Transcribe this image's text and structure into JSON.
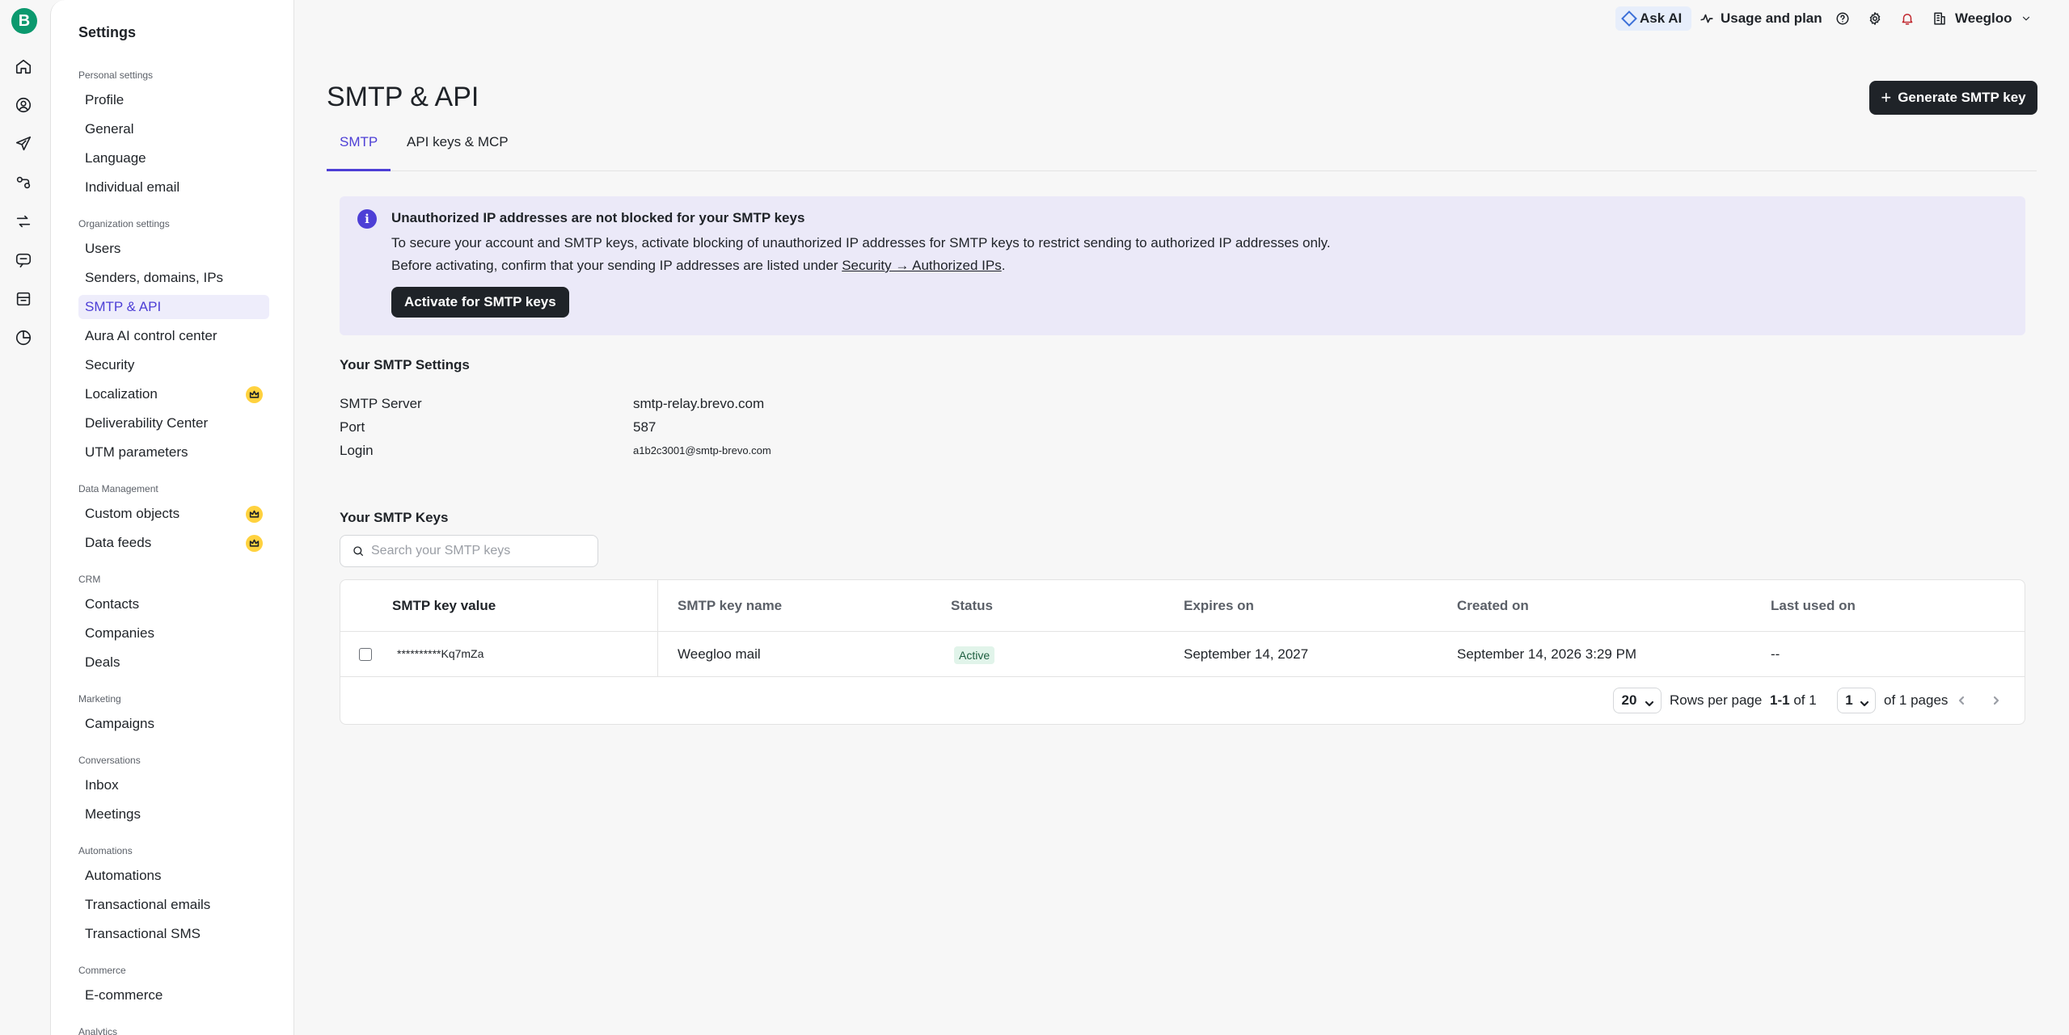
{
  "brand": {
    "logo_letter": "B",
    "accent": "#0b996e"
  },
  "topbar": {
    "ask_ai": "Ask AI",
    "usage": "Usage and plan",
    "account": "Weegloo"
  },
  "sidebar": {
    "title": "Settings",
    "sections": {
      "personal": "Personal settings",
      "organization": "Organization settings",
      "data": "Data Management",
      "crm": "CRM",
      "marketing": "Marketing",
      "conversations": "Conversations",
      "automations": "Automations",
      "commerce": "Commerce",
      "analytics": "Analytics"
    },
    "items": {
      "profile": "Profile",
      "general": "General",
      "language": "Language",
      "individual_email": "Individual email",
      "users": "Users",
      "senders": "Senders, domains, IPs",
      "smtp_api": "SMTP & API",
      "aura": "Aura AI control center",
      "security": "Security",
      "localization": "Localization",
      "deliverability": "Deliverability Center",
      "utm": "UTM parameters",
      "custom_objects": "Custom objects",
      "data_feeds": "Data feeds",
      "contacts": "Contacts",
      "companies": "Companies",
      "deals": "Deals",
      "campaigns": "Campaigns",
      "inbox": "Inbox",
      "meetings": "Meetings",
      "automations": "Automations",
      "transactional_emails": "Transactional emails",
      "transactional_sms": "Transactional SMS",
      "ecommerce": "E-commerce"
    }
  },
  "main": {
    "title": "SMTP & API",
    "generate_button": "Generate SMTP key",
    "tabs": [
      "SMTP",
      "API keys & MCP"
    ],
    "alert": {
      "title": "Unauthorized IP addresses are not blocked for your SMTP keys",
      "line1": "To secure your account and SMTP keys, activate blocking of unauthorized IP addresses for SMTP keys to restrict sending to authorized IP addresses only.",
      "line2_prefix": "Before activating, confirm that your sending IP addresses are listed under ",
      "line2_link": "Security → Authorized IPs",
      "line2_suffix": ".",
      "button": "Activate for SMTP keys"
    },
    "settings": {
      "heading": "Your SMTP Settings",
      "server_label": "SMTP Server",
      "server_value": "smtp-relay.brevo.com",
      "port_label": "Port",
      "port_value": "587",
      "login_label": "Login",
      "login_value": "a1b2c3001@smtp-brevo.com"
    },
    "keys": {
      "heading": "Your SMTP Keys",
      "search_placeholder": "Search your SMTP keys",
      "columns": [
        "SMTP key value",
        "SMTP key name",
        "Status",
        "Expires on",
        "Created on",
        "Last used on"
      ],
      "rows": [
        {
          "value": "**********Kq7mZa",
          "name": "Weegloo mail",
          "status": "Active",
          "expires": "September 14, 2027",
          "created": "September 14, 2026 3:29 PM",
          "last_used": "--"
        }
      ],
      "pagination": {
        "rows_per_page_value": "20",
        "rows_per_page_label": "Rows per page",
        "range": "1-1",
        "of_total": "of 1",
        "page_value": "1",
        "of_pages": "of 1 pages"
      }
    }
  }
}
